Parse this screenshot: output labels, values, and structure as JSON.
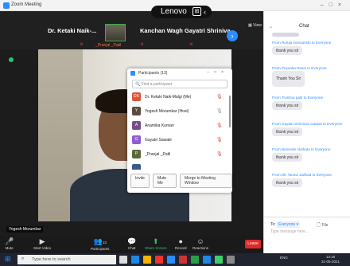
{
  "window": {
    "title": "Zoom Meeting"
  },
  "brand_overlay": {
    "text": "Lenovo",
    "extra": "‹"
  },
  "gallery": {
    "tiles": [
      {
        "name": "Dr. Ketaki Naik-..."
      },
      {
        "name": "Kanchan Wagh"
      },
      {
        "name": "Gayatri Shriniva..."
      }
    ],
    "thumb_label": "_Pranjal _Patil",
    "view_label": "View"
  },
  "speaker_label": "Yogesh Morumkar",
  "participants_panel": {
    "title": "Participants (13)",
    "search_placeholder": "Find a participant",
    "rows": [
      {
        "initials": "DK",
        "name": "Dr. Ketaki Naik-Malgi (Me)",
        "color": "#e0533b"
      },
      {
        "initials": "Y",
        "name": "Yogesh Morumkar (Host)",
        "color": "#5b4b43"
      },
      {
        "initials": "A",
        "name": "Anamika Kumari",
        "color": "#7a4b8b"
      },
      {
        "initials": "G",
        "name": "Gayatri Sawale",
        "color": "#8f5fd1"
      },
      {
        "initials": "P",
        "name": "_Pranjal _Patil",
        "color": "#5a6a3a"
      },
      {
        "initials": "",
        "name": "",
        "color": "#3a5a8b"
      }
    ],
    "buttons": [
      "Invite",
      "Mute Me",
      "Merge to Meeting Window"
    ]
  },
  "toolbar": {
    "items": [
      {
        "icon": "🎤",
        "label": "Mute"
      },
      {
        "icon": "▶",
        "label": "Start Video"
      },
      {
        "icon": "👥",
        "label": "Participants",
        "count": "13"
      },
      {
        "icon": "💬",
        "label": "Chat"
      },
      {
        "icon": "⬆",
        "label": "Share Screen"
      },
      {
        "icon": "●",
        "label": "Record"
      },
      {
        "icon": "☺",
        "label": "Reactions"
      }
    ],
    "leave": "Leave"
  },
  "chat": {
    "title": "Chat",
    "messages": [
      {
        "from": "From Rutuja somvanshi to Everyone",
        "text": "thank you sir"
      },
      {
        "from": "From Priyanka Desai to Everyone",
        "text": "Thank You Sir"
      },
      {
        "from": "From Trushna patil to Everyone",
        "text": "thank you sir"
      },
      {
        "from": "From Gayatri Shrinivas Gaidas to Everyone",
        "text": "thank you sir"
      },
      {
        "from": "From Bansode Akshata to Everyone",
        "text": "thank you sir"
      },
      {
        "from": "From DK Tanavi Jadhad to Everyone",
        "text": "thank you sir"
      }
    ],
    "to_label": "To:",
    "to_value": "Everyone ▾",
    "file_label": "File",
    "placeholder": "Type message here..."
  },
  "taskbar": {
    "search_placeholder": "Type here to search",
    "tray": "ENG",
    "time": "13:18",
    "date": "31-05-2021"
  }
}
